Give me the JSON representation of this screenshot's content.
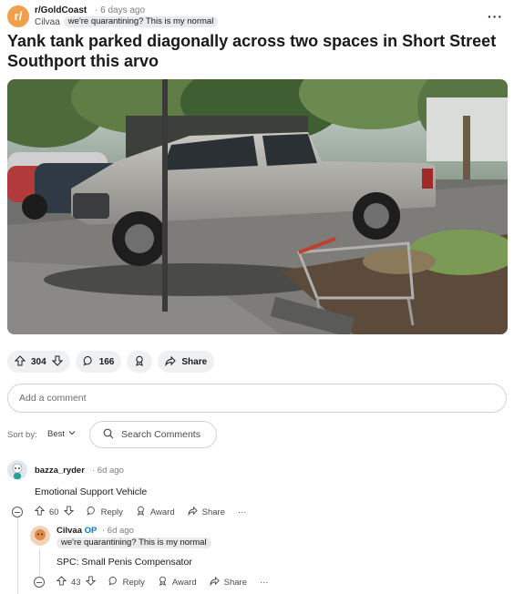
{
  "post": {
    "subreddit_initial": "r/",
    "subreddit": "r/GoldCoast",
    "age": "· 6 days ago",
    "author": "Cilvaa",
    "author_flair": "we're quarantining? This is my normal",
    "more_icon": "more-icon",
    "title": "Yank tank parked diagonally across two spaces in Short Street Southport this arvo",
    "image_icon": "photo"
  },
  "actions": {
    "votes": "304",
    "comments": "166",
    "share": "Share"
  },
  "comment_input": {
    "placeholder": "Add a comment"
  },
  "sort": {
    "label": "Sort by:",
    "value": "Best",
    "search_placeholder": "Search Comments"
  },
  "comments": [
    {
      "username": "bazza_ryder",
      "age": "· 6d ago",
      "text": "Emotional Support Vehicle",
      "votes": "60",
      "reply": "Reply",
      "award": "Award",
      "share": "Share",
      "more": "···"
    },
    {
      "username": "Cilvaa",
      "op_badge": "OP",
      "age": "· 6d ago",
      "flair": "we're quarantining? This is my normal",
      "text": "SPC: Small Penis Compensator",
      "votes": "43",
      "reply": "Reply",
      "award": "Award",
      "share": "Share",
      "more": "···"
    }
  ],
  "colors": {
    "subreddit_avatar": "#f0a04b",
    "op_badge": "#0079d3",
    "pill_bg": "#eef0f2"
  }
}
